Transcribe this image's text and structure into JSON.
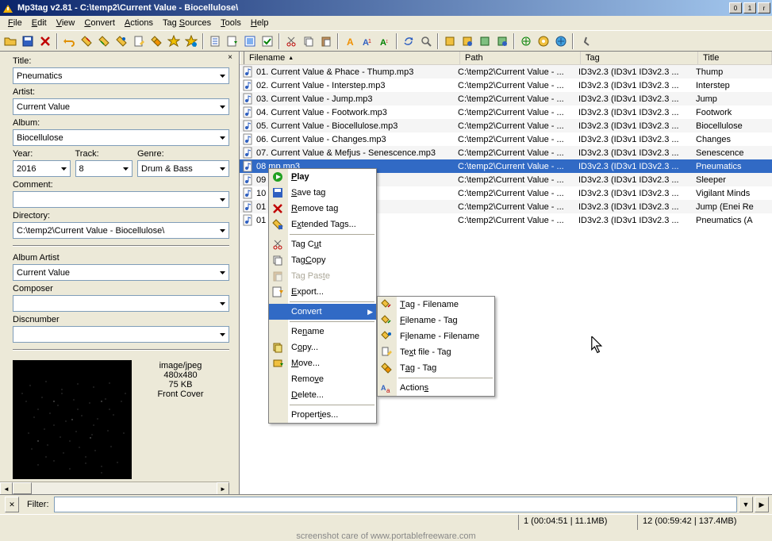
{
  "window": {
    "title": "Mp3tag v2.81  -  C:\\temp2\\Current Value - Biocellulose\\"
  },
  "menubar": [
    "File",
    "Edit",
    "View",
    "Convert",
    "Actions",
    "Tag Sources",
    "Tools",
    "Help"
  ],
  "form": {
    "title_label": "Title:",
    "title_value": "Pneumatics",
    "artist_label": "Artist:",
    "artist_value": "Current Value",
    "album_label": "Album:",
    "album_value": "Biocellulose",
    "year_label": "Year:",
    "year_value": "2016",
    "track_label": "Track:",
    "track_value": "8",
    "genre_label": "Genre:",
    "genre_value": "Drum & Bass",
    "comment_label": "Comment:",
    "comment_value": "",
    "directory_label": "Directory:",
    "directory_value": "C:\\temp2\\Current Value - Biocellulose\\",
    "album_artist_label": "Album Artist",
    "album_artist_value": "Current Value",
    "composer_label": "Composer",
    "composer_value": "",
    "discnumber_label": "Discnumber",
    "discnumber_value": ""
  },
  "cover": {
    "mime": "image/jpeg",
    "dims": "480x480",
    "size": "75 KB",
    "type": "Front Cover"
  },
  "columns": {
    "filename": "Filename",
    "path": "Path",
    "tag": "Tag",
    "title": "Title"
  },
  "rows": [
    {
      "fn": "01. Current Value & Phace - Thump.mp3",
      "p": "C:\\temp2\\Current Value - ...",
      "t": "ID3v2.3 (ID3v1 ID3v2.3 ...",
      "ti": "Thump"
    },
    {
      "fn": "02. Current Value - Interstep.mp3",
      "p": "C:\\temp2\\Current Value - ...",
      "t": "ID3v2.3 (ID3v1 ID3v2.3 ...",
      "ti": "Interstep"
    },
    {
      "fn": "03. Current Value - Jump.mp3",
      "p": "C:\\temp2\\Current Value - ...",
      "t": "ID3v2.3 (ID3v1 ID3v2.3 ...",
      "ti": "Jump"
    },
    {
      "fn": "04. Current Value - Footwork.mp3",
      "p": "C:\\temp2\\Current Value - ...",
      "t": "ID3v2.3 (ID3v1 ID3v2.3 ...",
      "ti": "Footwork"
    },
    {
      "fn": "05. Current Value - Biocellulose.mp3",
      "p": "C:\\temp2\\Current Value - ...",
      "t": "ID3v2.3 (ID3v1 ID3v2.3 ...",
      "ti": "Biocellulose"
    },
    {
      "fn": "06. Current Value - Changes.mp3",
      "p": "C:\\temp2\\Current Value - ...",
      "t": "ID3v2.3 (ID3v1 ID3v2.3 ...",
      "ti": "Changes"
    },
    {
      "fn": "07. Current Value & Mefjus - Senescence.mp3",
      "p": "C:\\temp2\\Current Value - ...",
      "t": "ID3v2.3 (ID3v1 ID3v2.3 ...",
      "ti": "Senescence"
    },
    {
      "fn": "08                                                          mp.mp3",
      "p": "C:\\temp2\\Current Value - ...",
      "t": "ID3v2.3 (ID3v1 ID3v2.3 ...",
      "ti": "Pneumatics"
    },
    {
      "fn": "09                                                          3",
      "p": "C:\\temp2\\Current Value - ...",
      "t": "ID3v2.3 (ID3v1 ID3v2.3 ...",
      "ti": "Sleeper"
    },
    {
      "fn": "10                                                         ds.mp3",
      "p": "C:\\temp2\\Current Value - ...",
      "t": "ID3v2.3 (ID3v1 ID3v2.3 ...",
      "ti": "Vigilant Minds"
    },
    {
      "fn": "01                                                          Remix).mp3",
      "p": "C:\\temp2\\Current Value - ...",
      "t": "ID3v2.3 (ID3v1 ID3v2.3 ...",
      "ti": "Jump (Enei Re"
    },
    {
      "fn": "01                                                          (Anode Remix).mp3",
      "p": "C:\\temp2\\Current Value - ...",
      "t": "ID3v2.3 (ID3v1 ID3v2.3 ...",
      "ti": "Pneumatics (A"
    }
  ],
  "ctx": {
    "play": "Play",
    "save_tag": "Save tag",
    "remove_tag": "Remove tag",
    "extended_tags": "Extended Tags...",
    "tag_cut": "Tag Cut",
    "tag_copy": "Tag Copy",
    "tag_paste": "Tag Paste",
    "export": "Export...",
    "convert": "Convert",
    "rename": "Rename",
    "copy": "Copy...",
    "move": "Move...",
    "remove": "Remove",
    "delete": "Delete...",
    "properties": "Properties..."
  },
  "sub": {
    "tag_filename": "Tag - Filename",
    "filename_tag": "Filename - Tag",
    "filename_filename": "Filename - Filename",
    "textfile_tag": "Text file - Tag",
    "tag_tag": "Tag - Tag",
    "actions": "Actions"
  },
  "filter": {
    "label": "Filter:"
  },
  "status": {
    "blank": "",
    "sel": "1 (00:04:51 | 11.1MB)",
    "total": "12 (00:59:42 | 137.4MB)"
  },
  "watermark": "screenshot care of www.portablefreeware.com"
}
